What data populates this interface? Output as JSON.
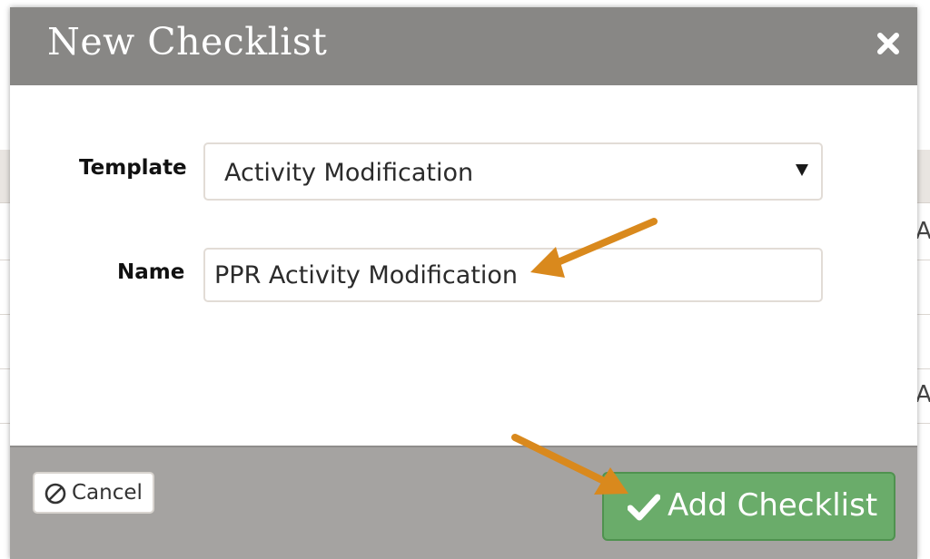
{
  "modal": {
    "title": "New Checklist",
    "close_icon": "close-icon"
  },
  "form": {
    "template_label": "Template",
    "template_selected": "Activity Modification",
    "name_label": "Name",
    "name_value": "PPR Activity Modification"
  },
  "footer": {
    "cancel_label": "Cancel",
    "cancel_icon": "prohibited-circle-icon",
    "add_label": "Add Checklist",
    "add_icon": "checkmark-icon"
  },
  "background": {
    "row_text_1": "A",
    "row_text_2": "A"
  },
  "colors": {
    "header_bg": "#888785",
    "footer_bg": "#a5a3a1",
    "primary_button": "#6aac6a",
    "annotation_arrow": "#d9891d"
  }
}
